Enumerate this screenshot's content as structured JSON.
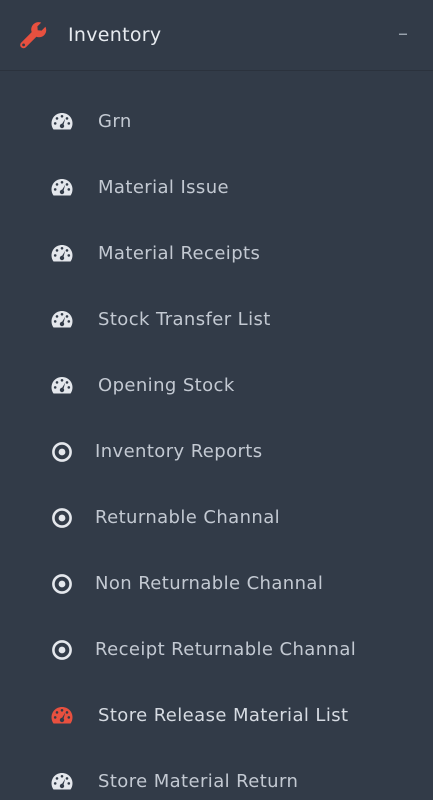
{
  "colors": {
    "background": "#323b48",
    "accent": "#e8503f",
    "icon_default": "#e4e7ec",
    "text": "#c3c9d2"
  },
  "header": {
    "icon": "wrench-icon",
    "title": "Inventory",
    "collapse_symbol": "–"
  },
  "menu": {
    "items": [
      {
        "label": "Grn",
        "icon": "dashboard-icon"
      },
      {
        "label": "Material Issue",
        "icon": "dashboard-icon"
      },
      {
        "label": "Material Receipts",
        "icon": "dashboard-icon"
      },
      {
        "label": "Stock Transfer List",
        "icon": "dashboard-icon"
      },
      {
        "label": "Opening Stock",
        "icon": "dashboard-icon"
      },
      {
        "label": "Inventory Reports",
        "icon": "circle-dot-icon"
      },
      {
        "label": "Returnable Channal",
        "icon": "circle-dot-icon"
      },
      {
        "label": "Non Returnable Channal",
        "icon": "circle-dot-icon"
      },
      {
        "label": "Receipt Returnable Channal",
        "icon": "circle-dot-icon"
      },
      {
        "label": "Store Release Material List",
        "icon": "dashboard-icon",
        "active": true
      },
      {
        "label": "Store Material Return",
        "icon": "dashboard-icon"
      }
    ]
  }
}
